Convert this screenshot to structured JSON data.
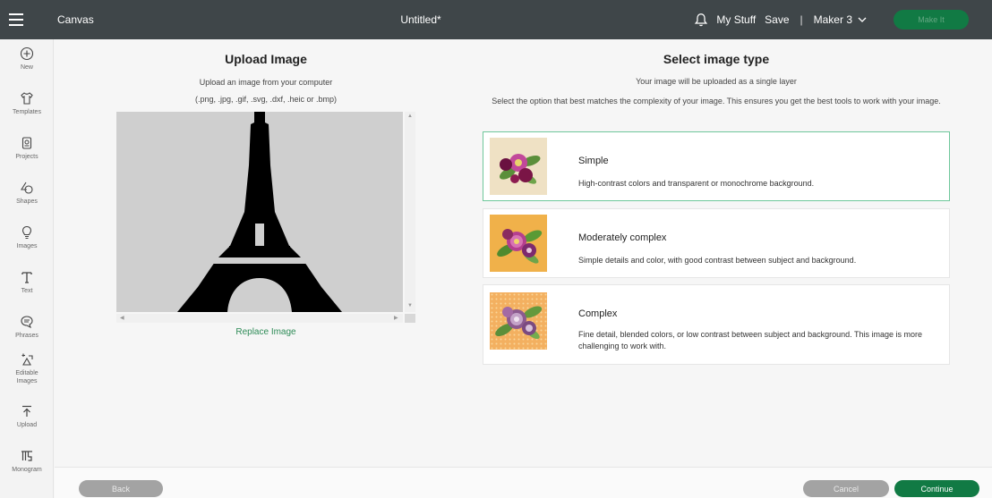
{
  "topbar": {
    "app_title": "Canvas",
    "doc_title": "Untitled*",
    "my_stuff": "My Stuff",
    "save": "Save",
    "separator": "|",
    "machine": "Maker 3",
    "make_it": "Make It"
  },
  "sidebar": {
    "items": [
      {
        "label": "New",
        "icon": "plus-circle-icon"
      },
      {
        "label": "Templates",
        "icon": "shirt-icon"
      },
      {
        "label": "Projects",
        "icon": "projects-icon"
      },
      {
        "label": "Shapes",
        "icon": "shapes-icon"
      },
      {
        "label": "Images",
        "icon": "lightbulb-icon"
      },
      {
        "label": "Text",
        "icon": "text-icon"
      },
      {
        "label": "Phrases",
        "icon": "speech-bubble-icon"
      },
      {
        "label": "Editable Images",
        "icon": "editable-images-icon"
      },
      {
        "label": "Upload",
        "icon": "upload-icon"
      },
      {
        "label": "Monogram",
        "icon": "monogram-icon"
      }
    ]
  },
  "upload": {
    "title": "Upload Image",
    "subtitle": "Upload an image from your computer",
    "formats": "(.png, .jpg, .gif, .svg, .dxf, .heic or .bmp)",
    "replace": "Replace Image"
  },
  "select": {
    "title": "Select image type",
    "line1": "Your image will be uploaded as a single layer",
    "line2": "Select the option that best matches the complexity of your image. This ensures you get the best tools to work with your image.",
    "options": [
      {
        "title": "Simple",
        "desc": "High-contrast colors and transparent or monochrome background.",
        "selected": true,
        "thumb_bg": "#efe1c4"
      },
      {
        "title": "Moderately complex",
        "desc": "Simple details and color, with good contrast between subject and background.",
        "selected": false,
        "thumb_bg": "#f0b14a"
      },
      {
        "title": "Complex",
        "desc": "Fine detail, blended colors, or low contrast between subject and background. This image is more challenging to work with.",
        "selected": false,
        "thumb_bg": "#f3b060"
      }
    ]
  },
  "footer": {
    "back": "Back",
    "cancel": "Cancel",
    "continue": "Continue"
  },
  "colors": {
    "topbar": "#3f4649",
    "accent_green": "#117a44",
    "selected_border": "#6fc79b"
  }
}
